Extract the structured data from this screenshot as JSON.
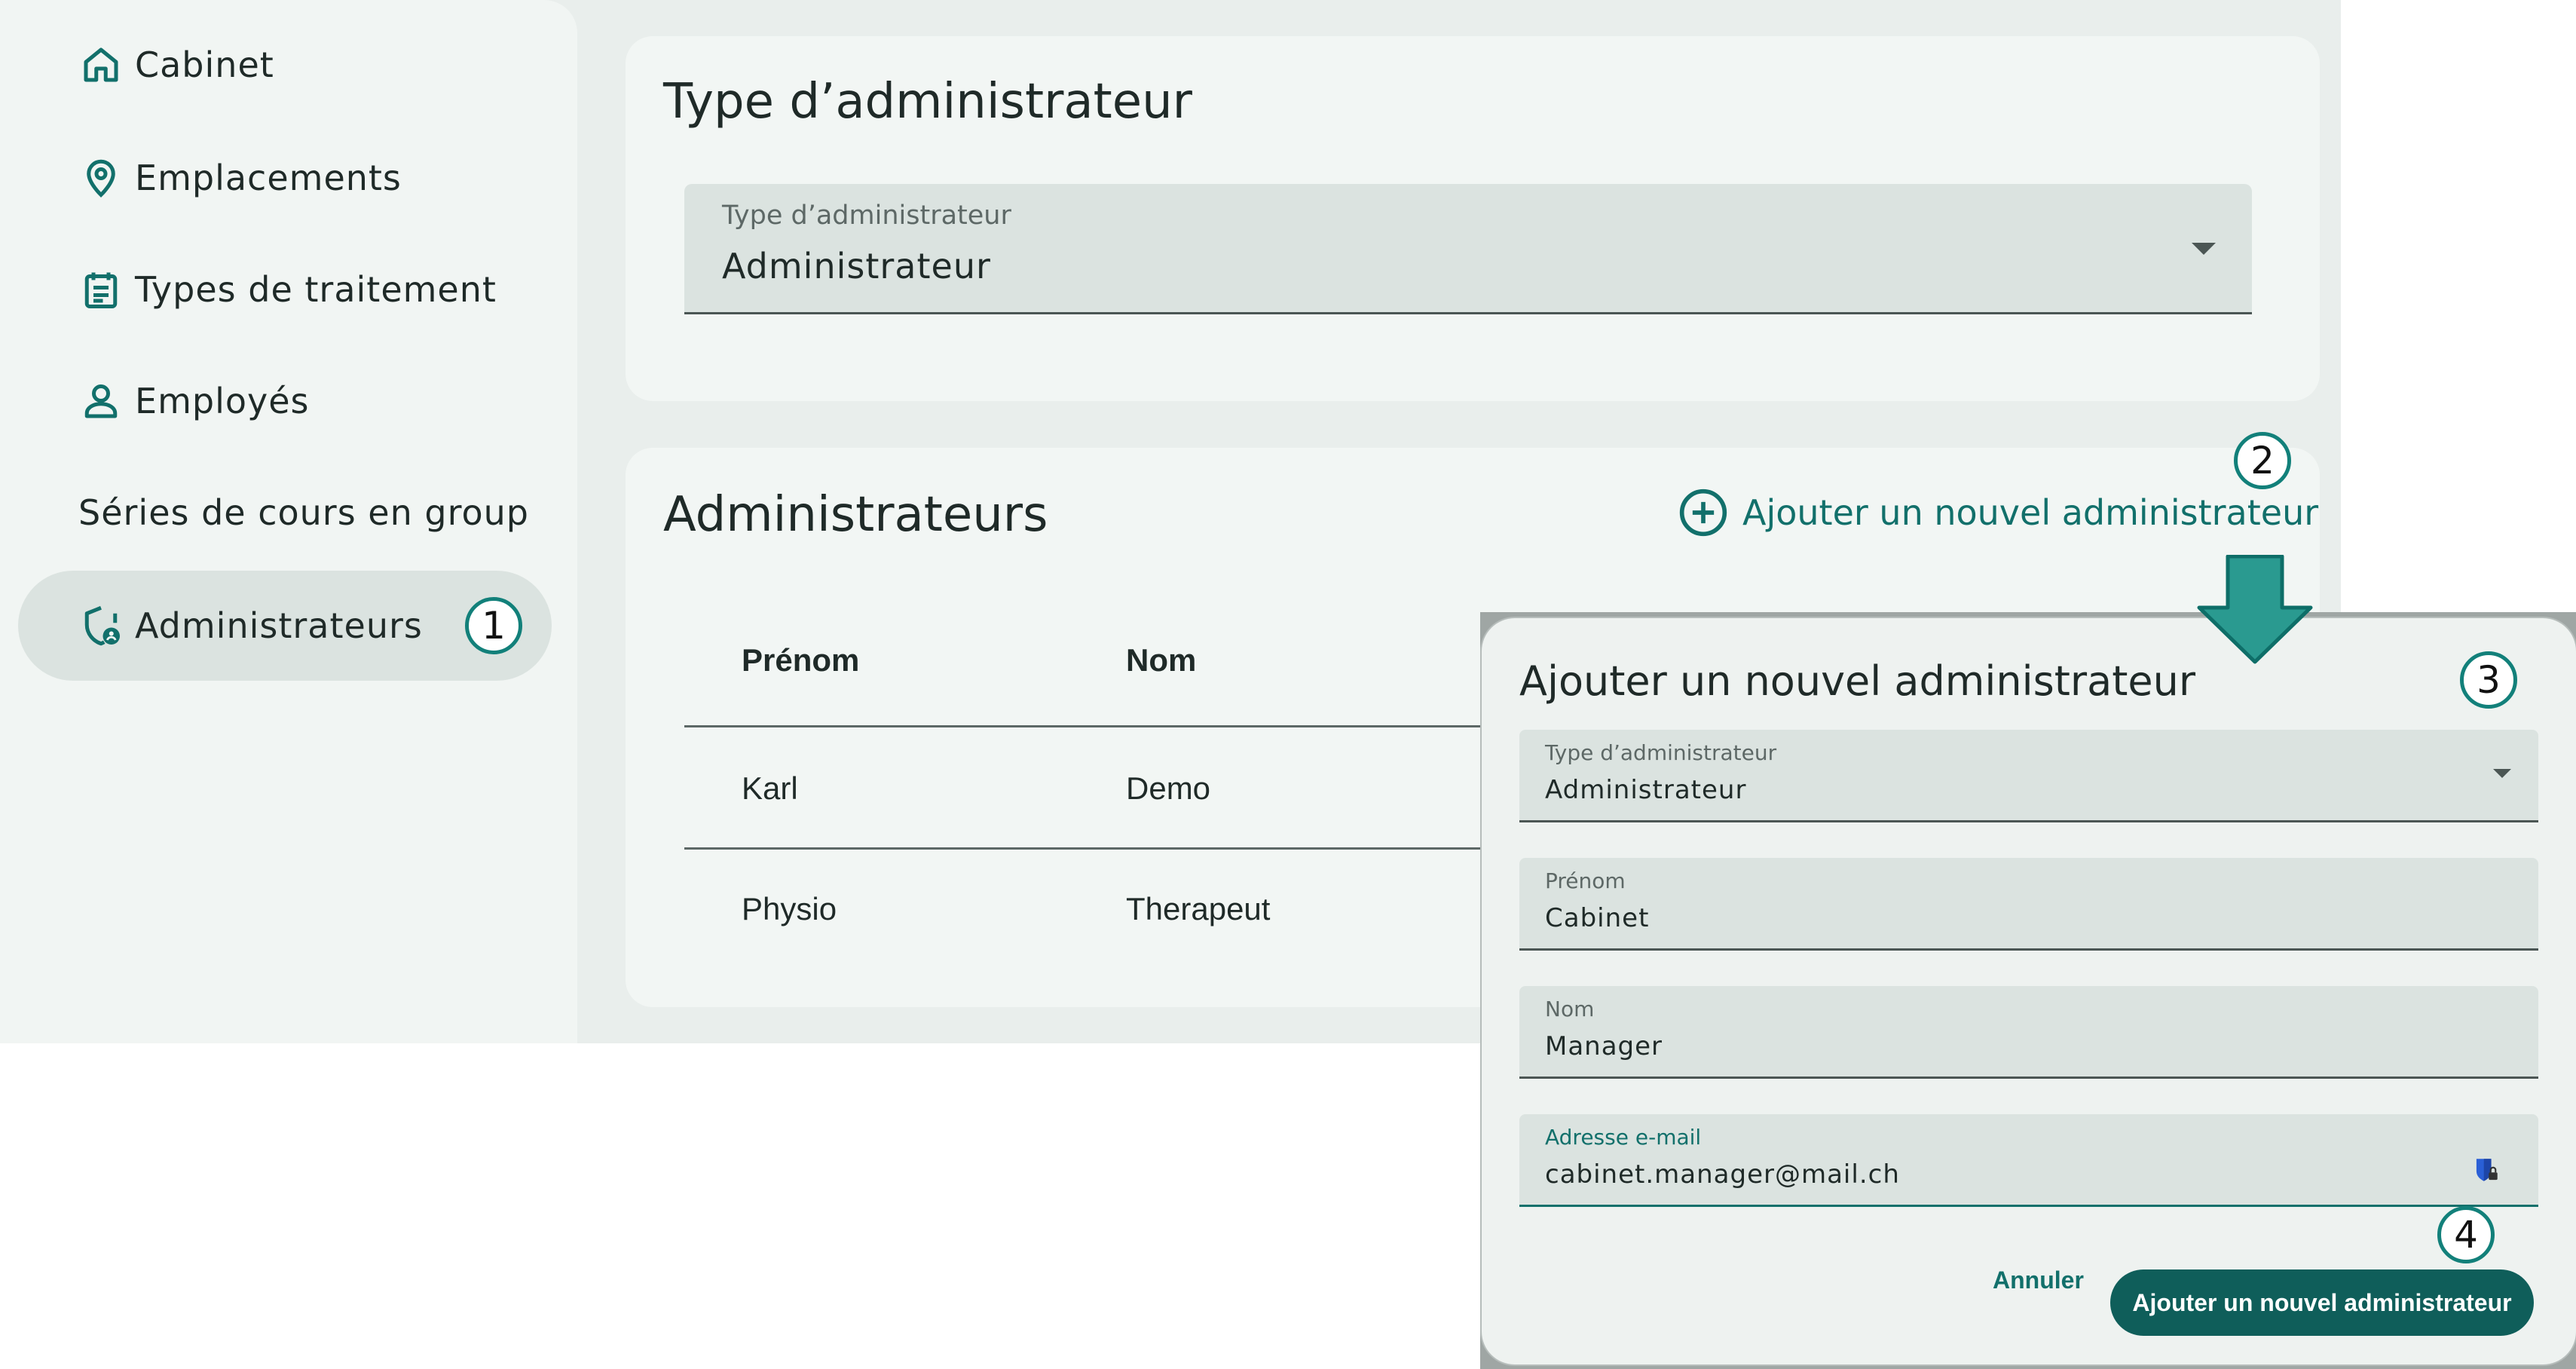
{
  "sidebar": {
    "items": [
      {
        "label": "Cabinet",
        "icon": "home-icon"
      },
      {
        "label": "Emplacements",
        "icon": "location-pin-icon"
      },
      {
        "label": "Types de traitement",
        "icon": "clipboard-list-icon"
      },
      {
        "label": "Employés",
        "icon": "person-icon"
      },
      {
        "label": "Séries de cours en group",
        "icon": ""
      },
      {
        "label": "Administrateurs",
        "icon": "shield-person-icon",
        "active": true
      }
    ]
  },
  "steps": {
    "one": "1",
    "two": "2",
    "three": "3",
    "four": "4"
  },
  "type_card": {
    "title": "Type d’administrateur",
    "select_label": "Type d’administrateur",
    "select_value": "Administrateur"
  },
  "admins_card": {
    "title": "Administrateurs",
    "add_label": "Ajouter un nouvel administrateur",
    "columns": [
      "Prénom",
      "Nom"
    ],
    "rows": [
      {
        "first": "Karl",
        "last": "Demo"
      },
      {
        "first": "Physio",
        "last": "Therapeut"
      }
    ]
  },
  "dialog": {
    "title": "Ajouter un nouvel administrateur",
    "fields": {
      "type": {
        "label": "Type d’administrateur",
        "value": "Administrateur"
      },
      "first": {
        "label": "Prénom",
        "value": "Cabinet"
      },
      "last": {
        "label": "Nom",
        "value": "Manager"
      },
      "email": {
        "label": "Adresse e-mail",
        "value": "cabinet.manager@mail.ch"
      }
    },
    "cancel_label": "Annuler",
    "submit_label": "Ajouter un nouvel administrateur"
  },
  "colors": {
    "accent": "#12706b",
    "primary_button": "#0f5e5a",
    "background": "#e9eeec"
  }
}
